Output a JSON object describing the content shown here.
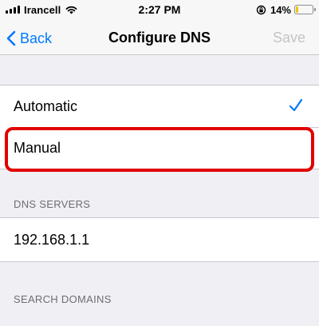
{
  "status_bar": {
    "carrier": "Irancell",
    "time": "2:27 PM",
    "battery_percent": "14%",
    "battery_level": 0.14,
    "battery_color": "#f4c400"
  },
  "nav_bar": {
    "back_label": "Back",
    "title": "Configure DNS",
    "save_label": "Save"
  },
  "dns_mode": {
    "options": [
      {
        "label": "Automatic",
        "selected": true
      },
      {
        "label": "Manual",
        "selected": false
      }
    ],
    "highlight_color": "#e10000"
  },
  "dns_servers": {
    "header": "DNS SERVERS",
    "items": [
      "192.168.1.1"
    ]
  },
  "search_domains": {
    "header": "SEARCH DOMAINS"
  },
  "colors": {
    "accent": "#007aff",
    "disabled": "#c4c4c8",
    "background": "#efeff4"
  },
  "icons": [
    "signal-icon",
    "wifi-icon",
    "rotation-lock-icon",
    "battery-icon",
    "chevron-left-icon",
    "checkmark-icon"
  ]
}
